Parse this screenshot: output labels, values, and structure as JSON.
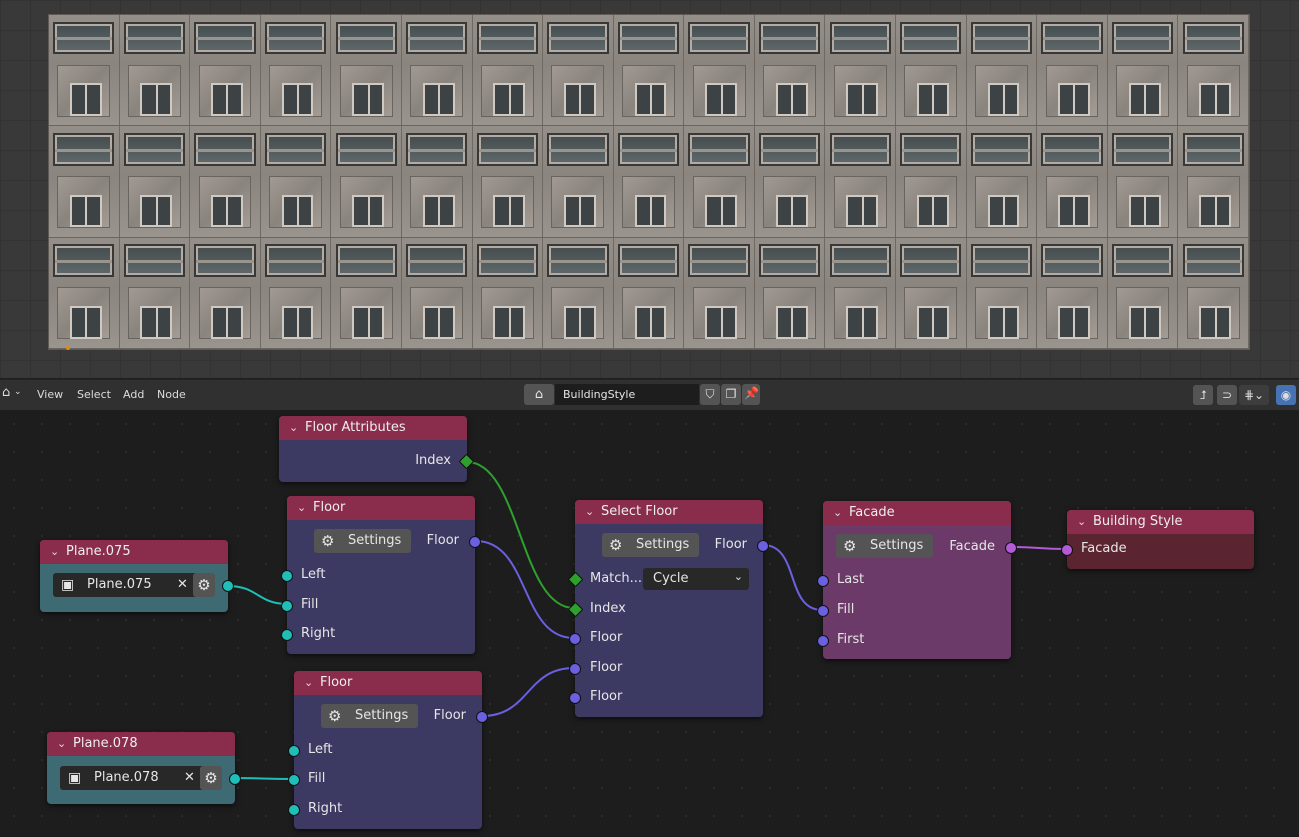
{
  "viewport": {
    "tile_columns": 17,
    "tile_rows": 3
  },
  "header": {
    "menus": [
      "View",
      "Select",
      "Add",
      "Node"
    ],
    "node_tree_name": "BuildingStyle",
    "icons": [
      "home-icon",
      "shield-icon",
      "duplicate-icon",
      "close-icon",
      "pin-icon",
      "parent-icon",
      "snap-icon",
      "overlay-icon",
      "gizmo-icon"
    ]
  },
  "nodes": {
    "floor_attributes": {
      "title": "Floor Attributes",
      "out": "Index"
    },
    "floor1": {
      "title": "Floor",
      "settings": "Settings",
      "out": "Floor",
      "inputs": [
        "Left",
        "Fill",
        "Right"
      ]
    },
    "floor2": {
      "title": "Floor",
      "settings": "Settings",
      "out": "Floor",
      "inputs": [
        "Left",
        "Fill",
        "Right"
      ]
    },
    "plane075": {
      "title": "Plane.075",
      "object": "Plane.075"
    },
    "plane078": {
      "title": "Plane.078",
      "object": "Plane.078"
    },
    "select_floor": {
      "title": "Select Floor",
      "settings": "Settings",
      "out": "Floor",
      "match_label": "Match...",
      "match_value": "Cycle",
      "inputs": [
        "Index",
        "Floor",
        "Floor",
        "Floor"
      ]
    },
    "facade": {
      "title": "Facade",
      "settings": "Settings",
      "out": "Facade",
      "inputs": [
        "Last",
        "Fill",
        "First"
      ]
    },
    "building_style": {
      "title": "Building Style",
      "input": "Facade"
    }
  },
  "colors": {
    "node_header": "#8a2c4b",
    "node_body": "#3c3a62",
    "facade_body": "#6b3a68",
    "output_body": "#5a2530",
    "socket_floor": "#6a60e0",
    "socket_object": "#1fbfb8",
    "socket_index": "#2ea02e",
    "socket_facade": "#b35ad6"
  }
}
